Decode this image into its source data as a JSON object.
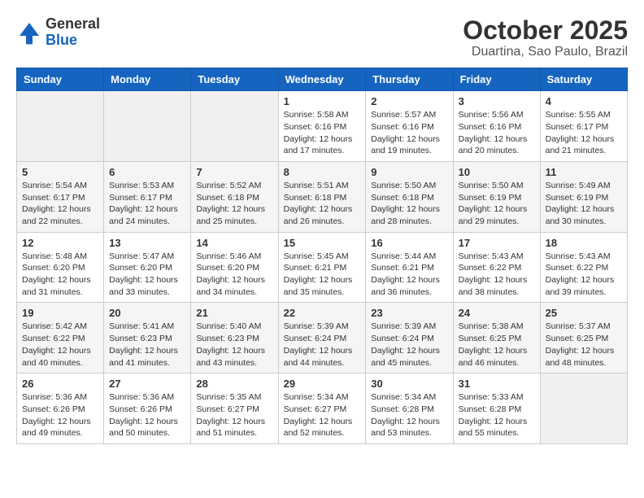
{
  "header": {
    "logo_general": "General",
    "logo_blue": "Blue",
    "month": "October 2025",
    "location": "Duartina, Sao Paulo, Brazil"
  },
  "days_of_week": [
    "Sunday",
    "Monday",
    "Tuesday",
    "Wednesday",
    "Thursday",
    "Friday",
    "Saturday"
  ],
  "weeks": [
    [
      {
        "day": "",
        "info": ""
      },
      {
        "day": "",
        "info": ""
      },
      {
        "day": "",
        "info": ""
      },
      {
        "day": "1",
        "info": "Sunrise: 5:58 AM\nSunset: 6:16 PM\nDaylight: 12 hours and 17 minutes."
      },
      {
        "day": "2",
        "info": "Sunrise: 5:57 AM\nSunset: 6:16 PM\nDaylight: 12 hours and 19 minutes."
      },
      {
        "day": "3",
        "info": "Sunrise: 5:56 AM\nSunset: 6:16 PM\nDaylight: 12 hours and 20 minutes."
      },
      {
        "day": "4",
        "info": "Sunrise: 5:55 AM\nSunset: 6:17 PM\nDaylight: 12 hours and 21 minutes."
      }
    ],
    [
      {
        "day": "5",
        "info": "Sunrise: 5:54 AM\nSunset: 6:17 PM\nDaylight: 12 hours and 22 minutes."
      },
      {
        "day": "6",
        "info": "Sunrise: 5:53 AM\nSunset: 6:17 PM\nDaylight: 12 hours and 24 minutes."
      },
      {
        "day": "7",
        "info": "Sunrise: 5:52 AM\nSunset: 6:18 PM\nDaylight: 12 hours and 25 minutes."
      },
      {
        "day": "8",
        "info": "Sunrise: 5:51 AM\nSunset: 6:18 PM\nDaylight: 12 hours and 26 minutes."
      },
      {
        "day": "9",
        "info": "Sunrise: 5:50 AM\nSunset: 6:18 PM\nDaylight: 12 hours and 28 minutes."
      },
      {
        "day": "10",
        "info": "Sunrise: 5:50 AM\nSunset: 6:19 PM\nDaylight: 12 hours and 29 minutes."
      },
      {
        "day": "11",
        "info": "Sunrise: 5:49 AM\nSunset: 6:19 PM\nDaylight: 12 hours and 30 minutes."
      }
    ],
    [
      {
        "day": "12",
        "info": "Sunrise: 5:48 AM\nSunset: 6:20 PM\nDaylight: 12 hours and 31 minutes."
      },
      {
        "day": "13",
        "info": "Sunrise: 5:47 AM\nSunset: 6:20 PM\nDaylight: 12 hours and 33 minutes."
      },
      {
        "day": "14",
        "info": "Sunrise: 5:46 AM\nSunset: 6:20 PM\nDaylight: 12 hours and 34 minutes."
      },
      {
        "day": "15",
        "info": "Sunrise: 5:45 AM\nSunset: 6:21 PM\nDaylight: 12 hours and 35 minutes."
      },
      {
        "day": "16",
        "info": "Sunrise: 5:44 AM\nSunset: 6:21 PM\nDaylight: 12 hours and 36 minutes."
      },
      {
        "day": "17",
        "info": "Sunrise: 5:43 AM\nSunset: 6:22 PM\nDaylight: 12 hours and 38 minutes."
      },
      {
        "day": "18",
        "info": "Sunrise: 5:43 AM\nSunset: 6:22 PM\nDaylight: 12 hours and 39 minutes."
      }
    ],
    [
      {
        "day": "19",
        "info": "Sunrise: 5:42 AM\nSunset: 6:22 PM\nDaylight: 12 hours and 40 minutes."
      },
      {
        "day": "20",
        "info": "Sunrise: 5:41 AM\nSunset: 6:23 PM\nDaylight: 12 hours and 41 minutes."
      },
      {
        "day": "21",
        "info": "Sunrise: 5:40 AM\nSunset: 6:23 PM\nDaylight: 12 hours and 43 minutes."
      },
      {
        "day": "22",
        "info": "Sunrise: 5:39 AM\nSunset: 6:24 PM\nDaylight: 12 hours and 44 minutes."
      },
      {
        "day": "23",
        "info": "Sunrise: 5:39 AM\nSunset: 6:24 PM\nDaylight: 12 hours and 45 minutes."
      },
      {
        "day": "24",
        "info": "Sunrise: 5:38 AM\nSunset: 6:25 PM\nDaylight: 12 hours and 46 minutes."
      },
      {
        "day": "25",
        "info": "Sunrise: 5:37 AM\nSunset: 6:25 PM\nDaylight: 12 hours and 48 minutes."
      }
    ],
    [
      {
        "day": "26",
        "info": "Sunrise: 5:36 AM\nSunset: 6:26 PM\nDaylight: 12 hours and 49 minutes."
      },
      {
        "day": "27",
        "info": "Sunrise: 5:36 AM\nSunset: 6:26 PM\nDaylight: 12 hours and 50 minutes."
      },
      {
        "day": "28",
        "info": "Sunrise: 5:35 AM\nSunset: 6:27 PM\nDaylight: 12 hours and 51 minutes."
      },
      {
        "day": "29",
        "info": "Sunrise: 5:34 AM\nSunset: 6:27 PM\nDaylight: 12 hours and 52 minutes."
      },
      {
        "day": "30",
        "info": "Sunrise: 5:34 AM\nSunset: 6:28 PM\nDaylight: 12 hours and 53 minutes."
      },
      {
        "day": "31",
        "info": "Sunrise: 5:33 AM\nSunset: 6:28 PM\nDaylight: 12 hours and 55 minutes."
      },
      {
        "day": "",
        "info": ""
      }
    ]
  ]
}
